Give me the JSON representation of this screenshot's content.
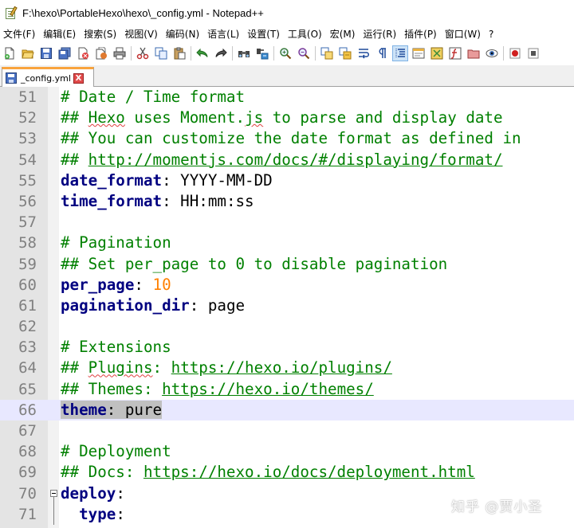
{
  "window": {
    "title": "F:\\hexo\\PortableHexo\\hexo\\_config.yml - Notepad++"
  },
  "menu": {
    "items": [
      "文件(F)",
      "编辑(E)",
      "搜索(S)",
      "视图(V)",
      "编码(N)",
      "语言(L)",
      "设置(T)",
      "工具(O)",
      "宏(M)",
      "运行(R)",
      "插件(P)",
      "窗口(W)",
      "?"
    ]
  },
  "toolbar": {
    "icons": [
      "new-file-icon",
      "open-file-icon",
      "save-icon",
      "save-all-icon",
      "close-icon",
      "close-all-icon",
      "print-icon",
      "cut-icon",
      "copy-icon",
      "paste-icon",
      "undo-icon",
      "redo-icon",
      "find-icon",
      "replace-icon",
      "zoom-in-icon",
      "zoom-out-icon",
      "sync-vertical-icon",
      "sync-horizontal-icon",
      "word-wrap-icon",
      "show-all-chars-icon",
      "indent-guide-icon",
      "user-language-icon",
      "doc-map-icon",
      "function-list-icon",
      "folder-workspace-icon",
      "monitoring-icon",
      "record-macro-icon",
      "stop-macro-icon"
    ],
    "active_icon": "indent-guide-icon"
  },
  "tab": {
    "label": "_config.yml",
    "close": "X"
  },
  "editor": {
    "current_line": 66,
    "lines": [
      {
        "num": "51",
        "parts": [
          {
            "t": "# Date / Time format",
            "s": "c"
          }
        ]
      },
      {
        "num": "52",
        "parts": [
          {
            "t": "## ",
            "s": "c"
          },
          {
            "t": "Hexo",
            "s": "c sq"
          },
          {
            "t": " uses Moment.",
            "s": "c"
          },
          {
            "t": "js",
            "s": "c sq"
          },
          {
            "t": " to parse and display date",
            "s": "c"
          }
        ]
      },
      {
        "num": "53",
        "parts": [
          {
            "t": "## You can customize the date format as defined in",
            "s": "c"
          }
        ]
      },
      {
        "num": "54",
        "parts": [
          {
            "t": "## ",
            "s": "c"
          },
          {
            "t": "http://momentjs.com/docs/#/displaying/format/",
            "s": "u"
          }
        ]
      },
      {
        "num": "55",
        "parts": [
          {
            "t": "date_format",
            "s": "k"
          },
          {
            "t": ": YYYY-MM-DD",
            "s": "v"
          }
        ]
      },
      {
        "num": "56",
        "parts": [
          {
            "t": "time_format",
            "s": "k"
          },
          {
            "t": ": HH:mm:ss",
            "s": "v"
          }
        ]
      },
      {
        "num": "57",
        "parts": []
      },
      {
        "num": "58",
        "parts": [
          {
            "t": "# Pagination",
            "s": "c"
          }
        ]
      },
      {
        "num": "59",
        "parts": [
          {
            "t": "## Set per_page to 0 to disable pagination",
            "s": "c"
          }
        ]
      },
      {
        "num": "60",
        "parts": [
          {
            "t": "per_page",
            "s": "k"
          },
          {
            "t": ": ",
            "s": "v"
          },
          {
            "t": "10",
            "s": "n"
          }
        ]
      },
      {
        "num": "61",
        "parts": [
          {
            "t": "pagination_dir",
            "s": "k"
          },
          {
            "t": ": page",
            "s": "v"
          }
        ]
      },
      {
        "num": "62",
        "parts": []
      },
      {
        "num": "63",
        "parts": [
          {
            "t": "# Extensions",
            "s": "c"
          }
        ]
      },
      {
        "num": "64",
        "parts": [
          {
            "t": "## ",
            "s": "c"
          },
          {
            "t": "Plugins",
            "s": "c sq"
          },
          {
            "t": ": ",
            "s": "c"
          },
          {
            "t": "https://hexo.io/plugins/",
            "s": "u"
          }
        ]
      },
      {
        "num": "65",
        "parts": [
          {
            "t": "## Themes: ",
            "s": "c"
          },
          {
            "t": "https://hexo.io/themes/",
            "s": "u"
          }
        ]
      },
      {
        "num": "66",
        "parts": [
          {
            "t": "theme",
            "s": "k sel"
          },
          {
            "t": ": pure",
            "s": "v sel"
          }
        ]
      },
      {
        "num": "67",
        "parts": []
      },
      {
        "num": "68",
        "parts": [
          {
            "t": "# Deployment",
            "s": "c"
          }
        ]
      },
      {
        "num": "69",
        "parts": [
          {
            "t": "## Docs: ",
            "s": "c"
          },
          {
            "t": "https://hexo.io/docs/deployment.html",
            "s": "u"
          }
        ]
      },
      {
        "num": "70",
        "parts": [
          {
            "t": "deploy",
            "s": "k"
          },
          {
            "t": ":",
            "s": "v"
          }
        ],
        "fold": "open"
      },
      {
        "num": "71",
        "parts": [
          {
            "t": "  ",
            "s": "v"
          },
          {
            "t": "type",
            "s": "k"
          },
          {
            "t": ":",
            "s": "v"
          }
        ],
        "fold": "line"
      }
    ]
  },
  "watermark": {
    "text": "知乎 @贾小圣"
  }
}
